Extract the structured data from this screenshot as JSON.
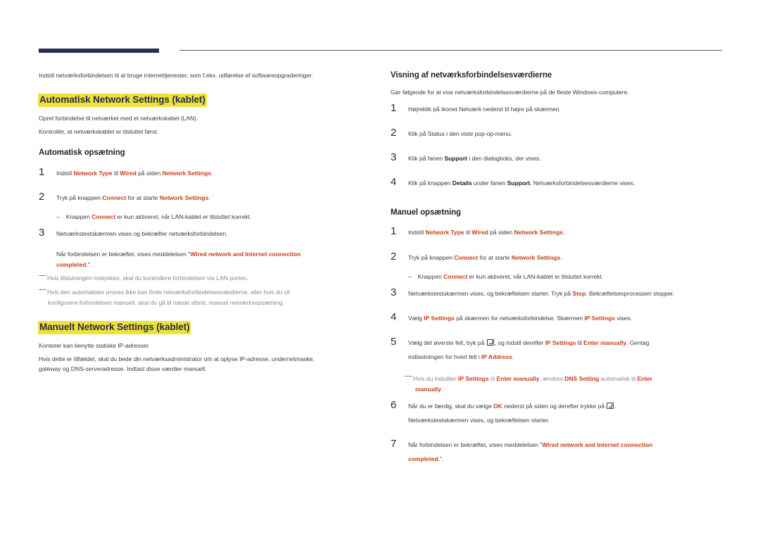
{
  "header": {
    "accent_color": "#252f4f",
    "rule_color": "#5b5b73"
  },
  "left": {
    "intro": "Indstil netværksforbindelsen til at bruge internettjenester, som f.eks. udførelse af softwareopgraderinger.",
    "auto_section": {
      "title": "Automatisk Network Settings (kablet)",
      "para1": "Opret forbindelse til netværket med et netværkskabel (LAN).",
      "para2": "Kontrollér, at netværkskablet er tilsluttet først.",
      "subtitle": "Automatisk opsætning",
      "steps": [
        {
          "num": "1",
          "t1": "Indstil ",
          "k1": "Network Type",
          "t2": " til ",
          "k2": "Wired",
          "t3": " på siden ",
          "k3": "Network Settings",
          "t4": "."
        },
        {
          "num": "2",
          "t1": "Tryk på knappen ",
          "k1": "Connect",
          "t2": " for at starte ",
          "k2": "Network Settings",
          "t3": "."
        },
        {
          "dash": "–",
          "t1": "Knappen ",
          "k1": "Connect",
          "t2": " er kun aktiveret, når LAN-kablet er tilsluttet korrekt."
        },
        {
          "num": "3",
          "t1": "Netværkstestskærmen vises og bekræfter netværksforbindelsen."
        },
        {
          "t1": "Når forbindelsen er bekræftet, vises meddelelsen \"",
          "k1": "Wired network and Internet connection",
          "k2": "completed.",
          "t2": "\"."
        }
      ],
      "notes": [
        "Hvis tilslutningen mislykkes, skal du kontrollere forbindelsen via LAN-porten.",
        "Hvis den automatiske proces ikke kan finde netværksforbindelsesværdierne, eller hvis du vil",
        "konfigurere forbindelsen manuelt, skal du gå til næste afsnit, manuel netværksopsætning."
      ]
    },
    "manual_section": {
      "title": "Manuelt Network Settings (kablet)",
      "para1": "Kontorer kan benytte statiske IP-adresser.",
      "para2_line1": "Hvis dette er tilfældet, skal du bede din netværksadministrator om at oplyse IP-adresse, undernetmaske,",
      "para2_line2": "gateway og DNS-serveradresse. Indtast disse værdier manuelt."
    }
  },
  "right": {
    "view_section": {
      "subtitle": "Visning af netværksforbindelsesværdierne",
      "intro": "Gør følgende for at vise netværksforbindelsesværdierne på de fleste Windows-computere.",
      "steps": [
        {
          "num": "1",
          "t1": "Højreklik på ikonet Netværk nederst til højre på skærmen."
        },
        {
          "num": "2",
          "t1": "Klik på Status i den viste pop-op-menu."
        },
        {
          "num": "3",
          "t1": "Klik på fanen ",
          "b1": "Support",
          "t2": " i den dialogboks, der vises."
        },
        {
          "num": "4",
          "t1": "Klik på knappen ",
          "b1": "Details",
          "t2": " under fanen ",
          "b2": "Support",
          "t3": ". Netværksforbindelsesværdierne vises."
        }
      ]
    },
    "manual_setup": {
      "subtitle": "Manuel opsætning",
      "steps": [
        {
          "num": "1",
          "t1": "Indstil ",
          "k1": "Network Type",
          "t2": " til ",
          "k2": "Wired",
          "t3": " på siden ",
          "k3": "Network Settings",
          "t4": "."
        },
        {
          "num": "2",
          "t1": "Tryk på knappen ",
          "k1": "Connect",
          "t2": " for at starte ",
          "k2": "Network Settings",
          "t3": "."
        },
        {
          "dash": "–",
          "t1": "Knappen ",
          "k1": "Connect",
          "t2": " er kun aktiveret, når LAN-kablet er tilsluttet korrekt."
        },
        {
          "num": "3",
          "t1": "Netværkstestskærmen vises, og bekræftelsen starter. Tryk på ",
          "k1": "Stop",
          "t2": ". Bekræftelsesprocessen stopper."
        },
        {
          "num": "4",
          "t1": "Vælg ",
          "k1": "IP Settings",
          "t2": " på skærmen for netværksforbindelse. Skærmen ",
          "k2": "IP Settings",
          "t3": " vises."
        },
        {
          "num": "5",
          "t1": "Vælg det øverste felt, tryk på ",
          "icon": "enter-key-icon",
          "t2": ", og indstil derefter ",
          "k1": "IP Settings",
          "t3": " til ",
          "k2": "Enter manually",
          "t4": ". Gentag",
          "l2_t1": "indtastningen for hvert felt i ",
          "l2_k1": "IP Address",
          "l2_t2": "."
        },
        {
          "note": true,
          "t1": "Hvis du indstiller ",
          "k1": "IP Settings",
          "t2": " til ",
          "k2": "Enter manually",
          "t3": ", ændres ",
          "k3": "DNS Setting",
          "t4": " automatisk til ",
          "k4": "Enter",
          "l2_k1": "manually",
          "l2_t1": "."
        },
        {
          "num": "6",
          "t1": "Når du er færdig, skal du vælge ",
          "k1": "OK",
          "t2": " nederst på siden og derefter trykke på ",
          "icon": "enter-key-icon",
          "t3": ".",
          "l2_t1": "Netværkstestskærmen vises, og bekræftelsen starter."
        },
        {
          "num": "7",
          "t1": "Når forbindelsen er bekræftet, vises meddelelsen \"",
          "k1": "Wired network and Internet connection",
          "l2_k1": "completed.",
          "l2_t1": "\"."
        }
      ]
    }
  },
  "colors": {
    "keyword": "#c8401a",
    "highlight": "#f0e03a",
    "title_text": "#252f4f",
    "note_text": "#8a8a8a"
  }
}
